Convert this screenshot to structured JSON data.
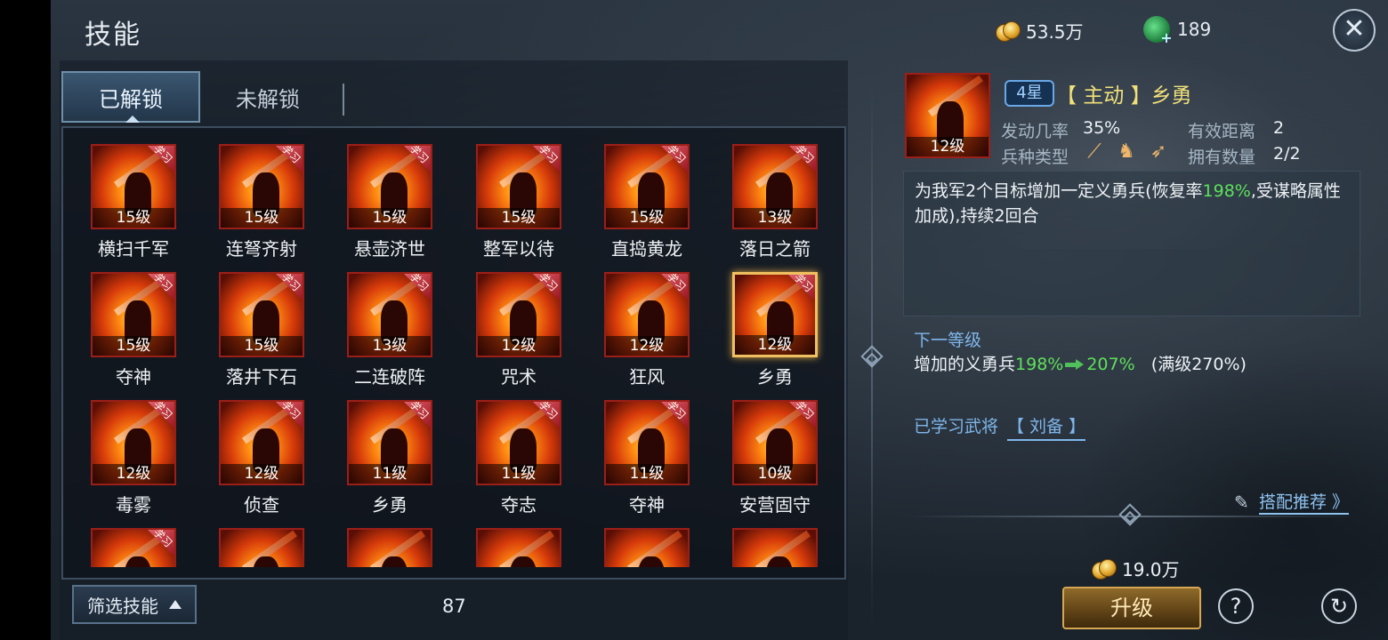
{
  "header": {
    "title": "技能",
    "gold": "53.5万",
    "jade": "189"
  },
  "tabs": [
    {
      "label": "已解锁",
      "active": true
    },
    {
      "label": "未解锁",
      "active": false
    }
  ],
  "learn_badge": "学习",
  "skills": [
    {
      "name": "横扫千军",
      "level": "15级"
    },
    {
      "name": "连弩齐射",
      "level": "15级"
    },
    {
      "name": "悬壶济世",
      "level": "15级"
    },
    {
      "name": "整军以待",
      "level": "15级"
    },
    {
      "name": "直捣黄龙",
      "level": "15级"
    },
    {
      "name": "落日之箭",
      "level": "13级"
    },
    {
      "name": "夺神",
      "level": "15级"
    },
    {
      "name": "落井下石",
      "level": "15级"
    },
    {
      "name": "二连破阵",
      "level": "13级"
    },
    {
      "name": "咒术",
      "level": "12级"
    },
    {
      "name": "狂风",
      "level": "12级"
    },
    {
      "name": "乡勇",
      "level": "12级"
    },
    {
      "name": "毒雾",
      "level": "12级"
    },
    {
      "name": "侦查",
      "level": "12级"
    },
    {
      "name": "乡勇",
      "level": "11级"
    },
    {
      "name": "夺志",
      "level": "11级"
    },
    {
      "name": "夺神",
      "level": "11级"
    },
    {
      "name": "安营固守",
      "level": "10级"
    }
  ],
  "filter": {
    "label": "筛选技能",
    "count": "87"
  },
  "detail": {
    "level": "12级",
    "star": "4星",
    "title": "【 主动 】乡勇",
    "trigger_label": "发动几率",
    "trigger_value": "35%",
    "range_label": "有效距离",
    "range_value": "2",
    "troop_label": "兵种类型",
    "own_label": "拥有数量",
    "own_value": "2/2",
    "desc_a": "为我军2个目标增加一定义勇兵(恢复率",
    "desc_green": "198%",
    "desc_b": ",受谋略属性加成),持续2回合",
    "next_label": "下一等级",
    "next_prefix": "增加的义勇兵",
    "next_from": "198%",
    "next_to": "207%",
    "next_max": "(满级270%)",
    "learned_label": "已学习武将",
    "learned_general": "【 刘备 】",
    "recommend": "搭配推荐 》",
    "cost": "19.0万",
    "upgrade": "升级"
  }
}
